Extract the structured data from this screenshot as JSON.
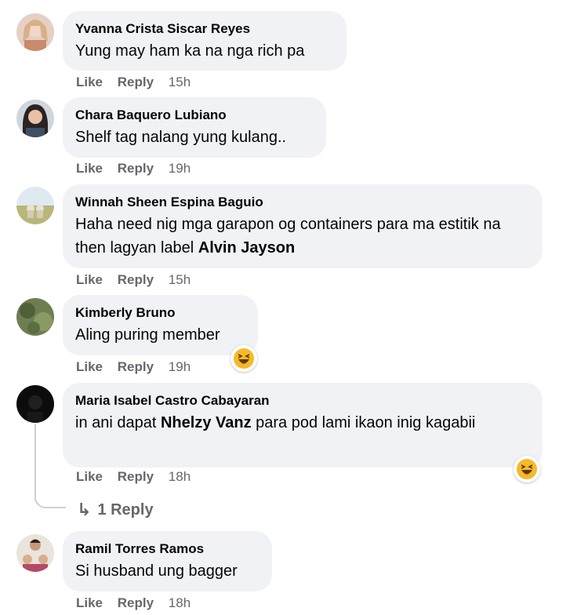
{
  "actions": {
    "like": "Like",
    "reply": "Reply"
  },
  "comments": [
    {
      "author": "Yvanna Crista Siscar Reyes",
      "text": [
        "Yung may ham ka na nga rich pa"
      ],
      "time": "15h",
      "avatar": "avatar-woman-blonde"
    },
    {
      "author": "Chara Baquero Lubiano",
      "text": [
        "Shelf tag nalang yung kulang.."
      ],
      "time": "19h",
      "avatar": "avatar-woman-dark-hair"
    },
    {
      "author": "Winnah Sheen Espina Baguio",
      "text_before": "Haha need nig mga garapon og containers para ma estitik na then lagyan label ",
      "mention": "Alvin Jayson",
      "time": "15h",
      "avatar": "avatar-field-photo"
    },
    {
      "author": "Kimberly Bruno",
      "text": [
        "Aling puring member"
      ],
      "time": "19h",
      "reaction": "haha-emoji-icon",
      "avatar": "avatar-greenery"
    },
    {
      "author": "Maria Isabel Castro Cabayaran",
      "text_before": "in ani dapat ",
      "mention": "Nhelzy Vanz",
      "text_after": " para pod lami ikaon inig kagabii",
      "time": "18h",
      "reaction": "haha-emoji-icon",
      "avatar": "avatar-dark"
    },
    {
      "author": "Ramil Torres Ramos",
      "text": [
        "Si husband ung bagger"
      ],
      "time": "18h",
      "avatar": "avatar-family"
    }
  ],
  "replies_link": "1 Reply",
  "colors": {
    "bubble": "#f0f2f5",
    "muted": "#65676b",
    "text": "#050505",
    "haha": "#f7b928"
  }
}
